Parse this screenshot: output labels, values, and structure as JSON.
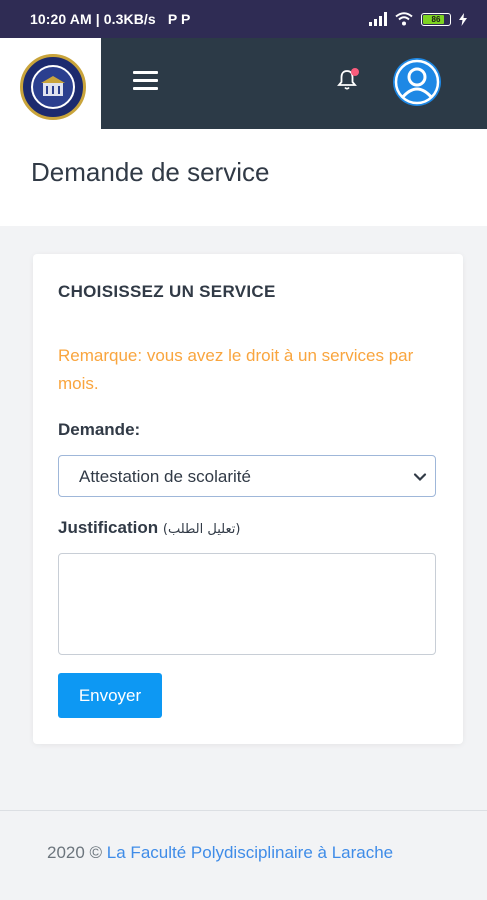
{
  "status_bar": {
    "time_speed": "10:20 AM | 0.3KB/s",
    "app_icons": "P  P",
    "battery": "86"
  },
  "header": {
    "logo_icon": "university-seal-logo",
    "menu_icon": "hamburger-menu-icon",
    "notification_icon": "bell-icon",
    "avatar_icon": "user-avatar-icon",
    "colors": {
      "topbar": "#2c3a47",
      "avatar": "#1e88e5",
      "badge": "#fa5c7c"
    }
  },
  "page": {
    "title": "Demande de service"
  },
  "card": {
    "title": "CHOISISSEZ UN SERVICE",
    "remark": "Remarque: vous avez le droit à un services par mois.",
    "demande_label": "Demande:",
    "demande_selected": "Attestation de scolarité",
    "justification_label": "Justification",
    "justification_label_ar": "(تعليل الطلب)",
    "justification_value": "",
    "submit_label": "Envoyer",
    "colors": {
      "remark": "#f9a53e",
      "button": "#0d98f3"
    }
  },
  "footer": {
    "copyright": "2020 © ",
    "link_text": "La Faculté Polydisciplinaire à Larache"
  }
}
